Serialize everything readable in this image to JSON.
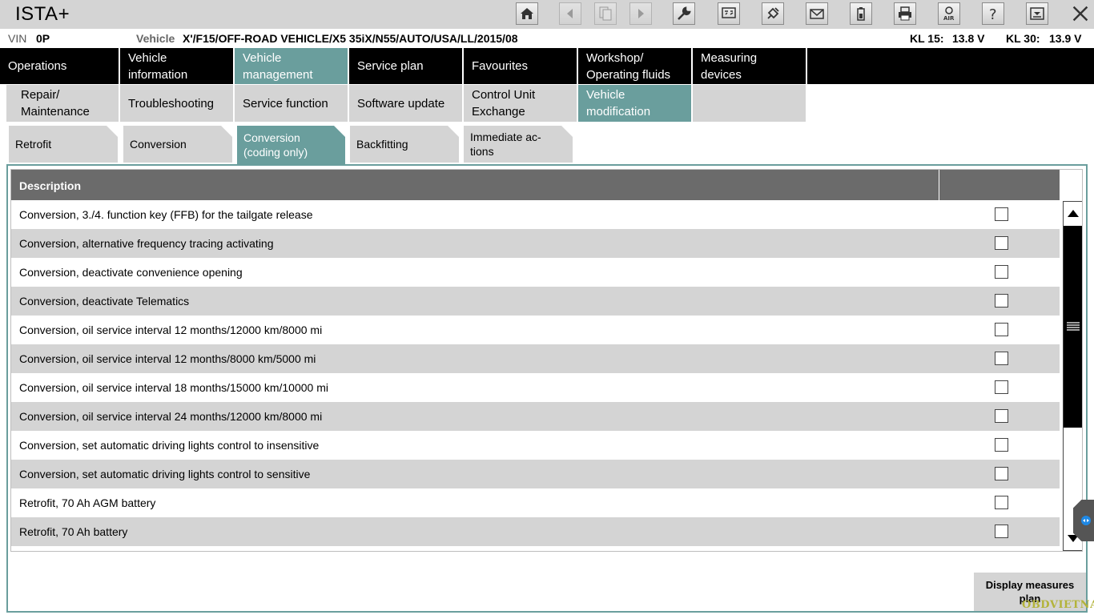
{
  "app": {
    "title": "ISTA+"
  },
  "vehicle": {
    "vin_label": "VIN",
    "vin_value": "0P",
    "vehicle_label": "Vehicle",
    "vehicle_value": "X'/F15/OFF-ROAD VEHICLE/X5 35iX/N55/AUTO/USA/LL/2015/08",
    "kl15_label": "KL 15:",
    "kl15_value": "13.8 V",
    "kl30_label": "KL 30:",
    "kl30_value": "13.9 V"
  },
  "main_nav": [
    {
      "label": "Operations"
    },
    {
      "label": "Vehicle information"
    },
    {
      "label": "Vehicle management"
    },
    {
      "label": "Service plan"
    },
    {
      "label": "Favourites"
    },
    {
      "label": "Workshop/ Operating fluids"
    },
    {
      "label": "Measuring devices"
    }
  ],
  "sub_nav": [
    {
      "label": "Repair/ Maintenance"
    },
    {
      "label": "Troubleshooting"
    },
    {
      "label": "Service function"
    },
    {
      "label": "Software update"
    },
    {
      "label": "Control Unit Exchange"
    },
    {
      "label": "Vehicle modification"
    }
  ],
  "tert_nav": [
    {
      "label": "Retrofit"
    },
    {
      "label": "Conversion"
    },
    {
      "label": "Conversion (coding only)"
    },
    {
      "label": "Backfitting"
    },
    {
      "label": "Immediate ac- tions"
    }
  ],
  "table": {
    "header_description": "Description",
    "rows": [
      {
        "description": "Conversion, 3./4. function key (FFB) for the tailgate release",
        "checked": false
      },
      {
        "description": "Conversion, alternative frequency tracing activating",
        "checked": false
      },
      {
        "description": "Conversion, deactivate convenience opening",
        "checked": false
      },
      {
        "description": "Conversion, deactivate Telematics",
        "checked": false
      },
      {
        "description": "Conversion, oil service interval 12 months/12000 km/8000 mi",
        "checked": false
      },
      {
        "description": "Conversion, oil service interval 12 months/8000 km/5000 mi",
        "checked": false
      },
      {
        "description": "Conversion, oil service interval 18 months/15000 km/10000 mi",
        "checked": false
      },
      {
        "description": "Conversion, oil service interval 24 months/12000 km/8000 mi",
        "checked": false
      },
      {
        "description": "Conversion, set automatic driving lights control to insensitive",
        "checked": false
      },
      {
        "description": "Conversion, set automatic driving lights control to sensitive",
        "checked": false
      },
      {
        "description": "Retrofit, 70 Ah AGM battery",
        "checked": false
      },
      {
        "description": "Retrofit, 70 Ah battery",
        "checked": false
      }
    ]
  },
  "actions": {
    "display_plan_label": "Display measures plan"
  },
  "watermark": "OBDVIETNAM",
  "colors": {
    "accent": "#6a9e9d",
    "nav_bg": "#000000",
    "tab_bg": "#d4d4d4",
    "header_bg": "#6b6b6b"
  }
}
